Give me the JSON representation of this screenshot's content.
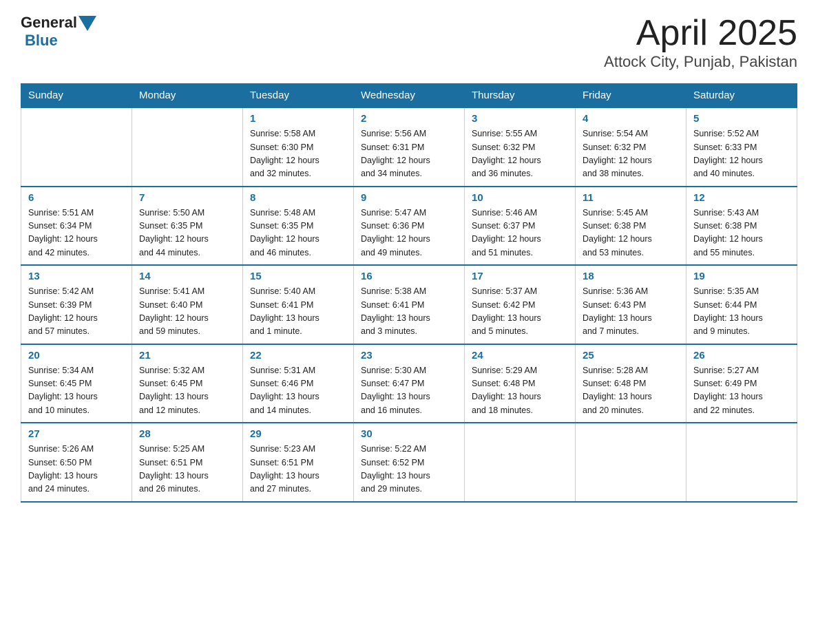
{
  "header": {
    "logo_general": "General",
    "logo_blue": "Blue",
    "title": "April 2025",
    "subtitle": "Attock City, Punjab, Pakistan"
  },
  "days_of_week": [
    "Sunday",
    "Monday",
    "Tuesday",
    "Wednesday",
    "Thursday",
    "Friday",
    "Saturday"
  ],
  "weeks": [
    [
      {
        "day": "",
        "info": ""
      },
      {
        "day": "",
        "info": ""
      },
      {
        "day": "1",
        "info": "Sunrise: 5:58 AM\nSunset: 6:30 PM\nDaylight: 12 hours\nand 32 minutes."
      },
      {
        "day": "2",
        "info": "Sunrise: 5:56 AM\nSunset: 6:31 PM\nDaylight: 12 hours\nand 34 minutes."
      },
      {
        "day": "3",
        "info": "Sunrise: 5:55 AM\nSunset: 6:32 PM\nDaylight: 12 hours\nand 36 minutes."
      },
      {
        "day": "4",
        "info": "Sunrise: 5:54 AM\nSunset: 6:32 PM\nDaylight: 12 hours\nand 38 minutes."
      },
      {
        "day": "5",
        "info": "Sunrise: 5:52 AM\nSunset: 6:33 PM\nDaylight: 12 hours\nand 40 minutes."
      }
    ],
    [
      {
        "day": "6",
        "info": "Sunrise: 5:51 AM\nSunset: 6:34 PM\nDaylight: 12 hours\nand 42 minutes."
      },
      {
        "day": "7",
        "info": "Sunrise: 5:50 AM\nSunset: 6:35 PM\nDaylight: 12 hours\nand 44 minutes."
      },
      {
        "day": "8",
        "info": "Sunrise: 5:48 AM\nSunset: 6:35 PM\nDaylight: 12 hours\nand 46 minutes."
      },
      {
        "day": "9",
        "info": "Sunrise: 5:47 AM\nSunset: 6:36 PM\nDaylight: 12 hours\nand 49 minutes."
      },
      {
        "day": "10",
        "info": "Sunrise: 5:46 AM\nSunset: 6:37 PM\nDaylight: 12 hours\nand 51 minutes."
      },
      {
        "day": "11",
        "info": "Sunrise: 5:45 AM\nSunset: 6:38 PM\nDaylight: 12 hours\nand 53 minutes."
      },
      {
        "day": "12",
        "info": "Sunrise: 5:43 AM\nSunset: 6:38 PM\nDaylight: 12 hours\nand 55 minutes."
      }
    ],
    [
      {
        "day": "13",
        "info": "Sunrise: 5:42 AM\nSunset: 6:39 PM\nDaylight: 12 hours\nand 57 minutes."
      },
      {
        "day": "14",
        "info": "Sunrise: 5:41 AM\nSunset: 6:40 PM\nDaylight: 12 hours\nand 59 minutes."
      },
      {
        "day": "15",
        "info": "Sunrise: 5:40 AM\nSunset: 6:41 PM\nDaylight: 13 hours\nand 1 minute."
      },
      {
        "day": "16",
        "info": "Sunrise: 5:38 AM\nSunset: 6:41 PM\nDaylight: 13 hours\nand 3 minutes."
      },
      {
        "day": "17",
        "info": "Sunrise: 5:37 AM\nSunset: 6:42 PM\nDaylight: 13 hours\nand 5 minutes."
      },
      {
        "day": "18",
        "info": "Sunrise: 5:36 AM\nSunset: 6:43 PM\nDaylight: 13 hours\nand 7 minutes."
      },
      {
        "day": "19",
        "info": "Sunrise: 5:35 AM\nSunset: 6:44 PM\nDaylight: 13 hours\nand 9 minutes."
      }
    ],
    [
      {
        "day": "20",
        "info": "Sunrise: 5:34 AM\nSunset: 6:45 PM\nDaylight: 13 hours\nand 10 minutes."
      },
      {
        "day": "21",
        "info": "Sunrise: 5:32 AM\nSunset: 6:45 PM\nDaylight: 13 hours\nand 12 minutes."
      },
      {
        "day": "22",
        "info": "Sunrise: 5:31 AM\nSunset: 6:46 PM\nDaylight: 13 hours\nand 14 minutes."
      },
      {
        "day": "23",
        "info": "Sunrise: 5:30 AM\nSunset: 6:47 PM\nDaylight: 13 hours\nand 16 minutes."
      },
      {
        "day": "24",
        "info": "Sunrise: 5:29 AM\nSunset: 6:48 PM\nDaylight: 13 hours\nand 18 minutes."
      },
      {
        "day": "25",
        "info": "Sunrise: 5:28 AM\nSunset: 6:48 PM\nDaylight: 13 hours\nand 20 minutes."
      },
      {
        "day": "26",
        "info": "Sunrise: 5:27 AM\nSunset: 6:49 PM\nDaylight: 13 hours\nand 22 minutes."
      }
    ],
    [
      {
        "day": "27",
        "info": "Sunrise: 5:26 AM\nSunset: 6:50 PM\nDaylight: 13 hours\nand 24 minutes."
      },
      {
        "day": "28",
        "info": "Sunrise: 5:25 AM\nSunset: 6:51 PM\nDaylight: 13 hours\nand 26 minutes."
      },
      {
        "day": "29",
        "info": "Sunrise: 5:23 AM\nSunset: 6:51 PM\nDaylight: 13 hours\nand 27 minutes."
      },
      {
        "day": "30",
        "info": "Sunrise: 5:22 AM\nSunset: 6:52 PM\nDaylight: 13 hours\nand 29 minutes."
      },
      {
        "day": "",
        "info": ""
      },
      {
        "day": "",
        "info": ""
      },
      {
        "day": "",
        "info": ""
      }
    ]
  ]
}
